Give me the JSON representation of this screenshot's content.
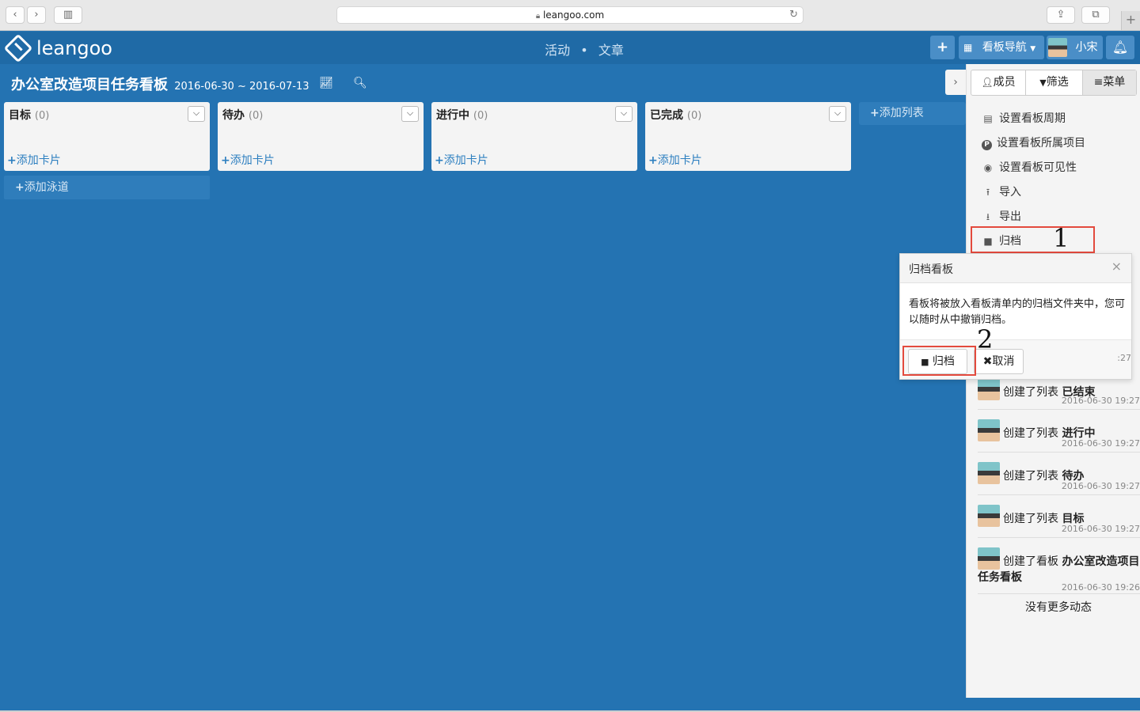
{
  "browser": {
    "url": "leangoo.com",
    "back_icon": "chevron-left-icon",
    "forward_icon": "chevron-right-icon",
    "sidebar_icon": "sidebar-icon",
    "reload_icon": "reload-icon",
    "share_icon": "share-icon",
    "tabs_icon": "tabs-icon",
    "new_tab": "+"
  },
  "header": {
    "logo_text": "leangoo",
    "nav": [
      "活动",
      "文章"
    ],
    "nav_separator": "•",
    "add_label": "+",
    "board_nav_label": "看板导航",
    "user_name": "小宋",
    "bell_icon": "bell-icon"
  },
  "board": {
    "title": "办公室改造项目任务看板",
    "dates": "2016-06-30 ~ 2016-07-13"
  },
  "lists": [
    {
      "name": "目标",
      "count": "(0)",
      "add_card": "添加卡片"
    },
    {
      "name": "待办",
      "count": "(0)",
      "add_card": "添加卡片"
    },
    {
      "name": "进行中",
      "count": "(0)",
      "add_card": "添加卡片"
    },
    {
      "name": "已完成",
      "count": "(0)",
      "add_card": "添加卡片"
    }
  ],
  "add_list_label": "添加列表",
  "add_lane_label": "添加泳道",
  "panel": {
    "tabs": [
      "成员",
      "筛选",
      "菜单"
    ],
    "menu": [
      {
        "label": "设置看板周期",
        "icon": "calendar-icon"
      },
      {
        "label": "设置看板所属项目",
        "icon": "project-icon"
      },
      {
        "label": "设置看板可见性",
        "icon": "eye-icon"
      },
      {
        "label": "导入",
        "icon": "upload-icon"
      },
      {
        "label": "导出",
        "icon": "download-icon"
      },
      {
        "label": "归档",
        "icon": "archive-icon"
      }
    ],
    "annotation_1": "1",
    "annotation_2": "2"
  },
  "popover": {
    "title": "归档看板",
    "close": "×",
    "body": "看板将被放入看板清单内的归档文件夹中，您可以随时从中撤销归档。",
    "confirm_label": "归档",
    "cancel_label": "取消",
    "time_stub": ":27"
  },
  "activity": [
    {
      "action": "创建了列表",
      "target": "已结束",
      "time": "2016-06-30 19:27"
    },
    {
      "action": "创建了列表",
      "target": "进行中",
      "time": "2016-06-30 19:27"
    },
    {
      "action": "创建了列表",
      "target": "待办",
      "time": "2016-06-30 19:27"
    },
    {
      "action": "创建了列表",
      "target": "目标",
      "time": "2016-06-30 19:27"
    },
    {
      "action": "创建了看板",
      "target": "办公室改造项目任务看板",
      "time": "2016-06-30 19:26"
    }
  ],
  "no_more": "没有更多动态"
}
